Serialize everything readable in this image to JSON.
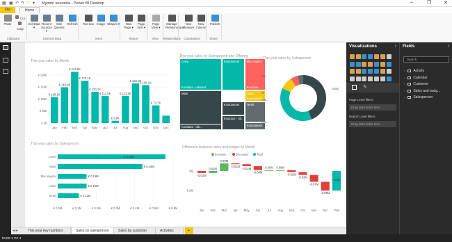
{
  "app": {
    "title": "Mymrin seuranta - Power BI Desktop",
    "brand_color": "#f2c811",
    "quick_access": [
      "save-icon",
      "undo-icon",
      "redo-icon",
      "smiley-icon",
      "dropdown-icon"
    ],
    "window_controls": [
      "minimize-icon",
      "restore-icon",
      "close-icon"
    ]
  },
  "ribbon": {
    "tabs": [
      "File",
      "Home"
    ],
    "buttons": [
      {
        "label": "Paste",
        "icon": "paste-icon",
        "color": "#8a8a8a"
      },
      {
        "label": "Cut",
        "icon": "cut-icon",
        "color": "#777"
      },
      {
        "label": "Copy",
        "icon": "copy-icon",
        "color": "#777"
      },
      {
        "label": "Get Data ▾",
        "icon": "get-data-icon",
        "color": "#6b7d8f"
      },
      {
        "label": "Recent Sources ▾",
        "icon": "recent-sources-icon",
        "color": "#6b7d8f"
      },
      {
        "label": "Edit Queries",
        "icon": "edit-queries-icon",
        "color": "#6b7d8f"
      },
      {
        "label": "Refresh",
        "icon": "refresh-icon",
        "color": "#3a8fd1"
      },
      {
        "label": "Text box",
        "icon": "text-box-icon",
        "color": "#555"
      },
      {
        "label": "Image",
        "icon": "image-icon",
        "color": "#3a8fd1"
      },
      {
        "label": "Shapes ▾",
        "icon": "shapes-icon",
        "color": "#3a8fd1"
      },
      {
        "label": "New Page ▾",
        "icon": "new-page-icon",
        "color": "#555"
      },
      {
        "label": "Page Size ▾",
        "icon": "page-size-icon",
        "color": "#555"
      },
      {
        "label": "Page View ▾",
        "icon": "page-view-icon",
        "color": "#aaa"
      },
      {
        "label": "Manage Relationships",
        "icon": "manage-relationships-icon",
        "color": "#555"
      },
      {
        "label": "New Measure",
        "icon": "new-measure-icon",
        "color": "#555"
      },
      {
        "label": "New Column",
        "icon": "new-column-icon",
        "color": "#555"
      },
      {
        "label": "Publish",
        "icon": "publish-icon",
        "color": "#3a8fd1"
      }
    ],
    "groups": [
      "Clipboard",
      "External Data",
      "Insert",
      "Report",
      "View",
      "Relationships",
      "Calculations",
      "Share"
    ]
  },
  "leftnav": [
    "report-view-icon",
    "data-view-icon",
    "relationships-view-icon"
  ],
  "charts": {
    "monthly": {
      "title": "This year sales by Month",
      "color": "#01b8aa",
      "chart_data": {
        "type": "bar",
        "categories": [
          "Jan",
          "Feb",
          "Mar",
          "Apr",
          "May",
          "Jun",
          "Jul",
          "Aug",
          "Sep",
          "Oct",
          "Nov",
          "Dec"
        ],
        "values": [
          108.1,
          148.9,
          213.6,
          176.1,
          130.1,
          112.5,
          9.6,
          113.5,
          165.3,
          158.1,
          73.7,
          31
        ],
        "labels": [
          "€ 108.1K",
          "€ 148.9K",
          "€ 213.6K",
          "€ 176.1K",
          "€ 130.1K",
          "€ 112.5K",
          "€ 9.6K",
          "€ 113.5K",
          "€ 165.3K",
          "€ 158.1K",
          "€ 73.7K",
          ""
        ],
        "yticks": [
          "€ 0K",
          "€ 50K",
          "€ 100K",
          "€ 150K",
          "€ 200K"
        ],
        "ylim": [
          0,
          220
        ]
      }
    },
    "treemap": {
      "title": "This year sales by Salesperson and Offering",
      "warning_icon": "warning-icon",
      "cells": [
        {
          "label": "Leevi",
          "sub": "Koulutus - ulkoiset",
          "color": "#01b8aa"
        },
        {
          "label": "Koulutukset",
          "sub": "",
          "color": "#01b8aa"
        },
        {
          "label": "Muu myymi",
          "sub": "Koulutus",
          "color": "#fd625e"
        },
        {
          "label": "Lassi",
          "sub": "Koulutukset",
          "color": "#f2c811"
        },
        {
          "label": "Masi",
          "sub": "Koulutus - ulkoiset",
          "color": "#374649"
        },
        {
          "label": "Koulutus - ulk...",
          "sub": "",
          "color": "#374649"
        },
        {
          "label": "Koulutukset",
          "sub": "",
          "color": "#374649"
        },
        {
          "label": "Koulutus - ob...",
          "sub": "",
          "color": "#374649"
        },
        {
          "label": "Tentti",
          "sub": "",
          "color": "#5f6b6d"
        },
        {
          "label": "Koulutukset",
          "sub": "",
          "color": "#5f6b6d"
        }
      ]
    },
    "donut": {
      "title": "This year sales by Salesperson",
      "chart_data": {
        "type": "pie",
        "series": [
          {
            "name": "Masi",
            "value": 44,
            "color": "#374649"
          },
          {
            "name": "Leevi",
            "value": 38,
            "color": "#01b8aa"
          },
          {
            "name": "Lassi",
            "value": 9,
            "color": "#f2c811"
          },
          {
            "name": "Tentti",
            "value": 5,
            "color": "#fd625e"
          },
          {
            "name": "Muu myymi",
            "value": 4,
            "color": "#5f6b6d"
          }
        ],
        "slice_labels": [
          "Masi",
          "Lee...",
          "Las...",
          "Te...",
          "Mu..."
        ]
      }
    },
    "hbar": {
      "title": "This year sales by Salesperson",
      "color": "#01b8aa",
      "chart_data": {
        "type": "bar",
        "orientation": "horizontal",
        "categories": [
          "Leevi",
          "Masi",
          "Muu myymi",
          "Lassi",
          "Tentti"
        ],
        "values": [
          0.56,
          0.44,
          0.15,
          0.15,
          0.11
        ],
        "labels": [
          "€ 0.56M",
          "€ 0.44M",
          "€ 0.15M",
          "€ 0.15M",
          "€ 0.11M"
        ],
        "xticks": [
          "€ 0.0M",
          "€ 0.1M",
          "€ 0.2M",
          "€ 0.3M",
          "€ 0.4M",
          "€ 0.5M",
          "€ 0.6M"
        ],
        "xlim": [
          0,
          0.6
        ]
      }
    },
    "waterfall": {
      "title": "Difference between sales and budget by Month",
      "legend": [
        {
          "label": "Increase",
          "color": "#5fb65f"
        },
        {
          "label": "Decrease",
          "color": "#e0403c"
        },
        {
          "label": "Total",
          "color": "#01b8aa"
        }
      ],
      "chart_data": {
        "type": "waterfall",
        "categories": [
          "Jan",
          "Feb",
          "Mar",
          "Apr",
          "May",
          "Jun",
          "Jul",
          "Aug",
          "Sep",
          "Oct",
          "Nov",
          "Dec",
          "Total"
        ],
        "values": [
          -0.02,
          0.02,
          0.08,
          -0.01,
          -0.02,
          -0.04,
          0.0,
          0.0,
          -0.02,
          -0.03,
          -0.07,
          -0.09,
          -0.2
        ],
        "labels": [
          "-0.02M",
          "0.02M",
          "0.08M",
          "-0.01M",
          "-0.02M",
          "-0.04M",
          "0.00M",
          "0.00M",
          "-0.02M",
          "-0.03M",
          "-0.07M",
          "-0.09M",
          "0.74M"
        ],
        "yticks": [
          "0M",
          "0.2M"
        ]
      }
    }
  },
  "visualizations": {
    "title": "Visualizations",
    "icons": [
      {
        "name": "stacked-bar-icon",
        "c": "#d9a04a"
      },
      {
        "name": "stacked-column-icon",
        "c": "#d9a04a"
      },
      {
        "name": "clustered-bar-icon",
        "c": "#3a8fd1"
      },
      {
        "name": "clustered-column-icon",
        "c": "#3a8fd1"
      },
      {
        "name": "100-bar-icon",
        "c": "#d9a04a"
      },
      {
        "name": "100-column-icon",
        "c": "#d9a04a"
      },
      {
        "name": "line-chart-icon",
        "c": "#ccc"
      },
      {
        "name": "area-chart-icon",
        "c": "#3a8fd1"
      },
      {
        "name": "stacked-area-icon",
        "c": "#3a8fd1"
      },
      {
        "name": "line-column-icon",
        "c": "#d9a04a"
      },
      {
        "name": "line-clustered-icon",
        "c": "#d9a04a"
      },
      {
        "name": "ribbon-chart-icon",
        "c": "#3a8fd1"
      },
      {
        "name": "waterfall-icon",
        "c": "#d9a04a"
      },
      {
        "name": "scatter-icon",
        "c": "#3a8fd1"
      },
      {
        "name": "pie-icon",
        "c": "#d9a04a"
      },
      {
        "name": "donut-icon",
        "c": "#d9a04a"
      },
      {
        "name": "treemap-icon",
        "c": "#3a8fd1"
      },
      {
        "name": "map-icon",
        "c": "#3a8fd1"
      },
      {
        "name": "filled-map-icon",
        "c": "#3a8fd1"
      },
      {
        "name": "funnel-icon",
        "c": "#d9a04a"
      },
      {
        "name": "gauge-icon",
        "c": "#ccc"
      },
      {
        "name": "card-icon",
        "c": "#ccc"
      },
      {
        "name": "multi-card-icon",
        "c": "#ccc"
      },
      {
        "name": "kpi-icon",
        "c": "#ccc"
      },
      {
        "name": "slicer-icon",
        "c": "#ccc"
      },
      {
        "name": "table-icon",
        "c": "#ccc"
      },
      {
        "name": "matrix-icon",
        "c": "#ccc"
      },
      {
        "name": "r-visual-icon",
        "c": "#3a8fd1"
      },
      {
        "name": "globe-icon",
        "c": "#3a8fd1"
      },
      {
        "name": "more-visuals-icon",
        "c": "#ccc"
      }
    ],
    "tabs": [
      "fields-well-icon",
      "format-paint-icon"
    ],
    "page_filters": "Page Level filters",
    "page_drop": "Drag data fields here",
    "report_filters": "Report Level filters",
    "report_drop": "Drag data fields here"
  },
  "fields": {
    "title": "Fields",
    "search_placeholder": "Search",
    "tables": [
      "Activity",
      "Calendar",
      "Customer",
      "Sales and budg...",
      "Salesperson"
    ]
  },
  "page_tabs": [
    "This year key numbers",
    "Sales by salesperson",
    "Sales by customer",
    "Activities"
  ],
  "active_tab": 1,
  "status": "PAGE 2 OF 4"
}
